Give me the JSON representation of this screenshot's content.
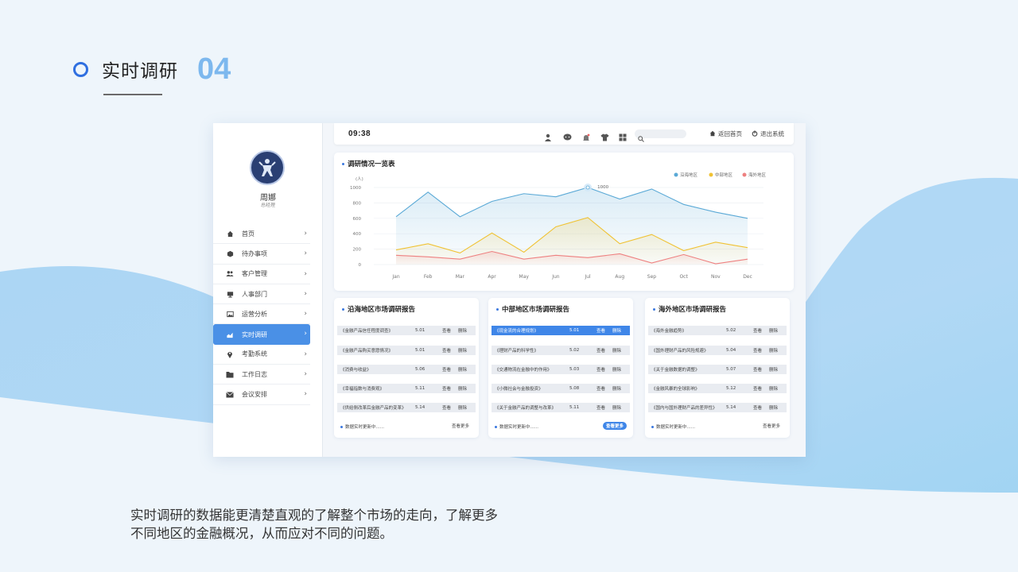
{
  "slide": {
    "title": "实时调研",
    "number": "04",
    "caption_line1": "实时调研的数据能更清楚直观的了解整个市场的走向，了解更多",
    "caption_line2": "不同地区的金融概况，从而应对不同的问题。"
  },
  "colors": {
    "accent_blue": "#2f6fe0",
    "menu_active": "#4a90e6",
    "series_coastal": "#5aa9d6",
    "series_central": "#f0c232",
    "series_overseas": "#ee8080"
  },
  "user": {
    "name": "周娜",
    "role": "总经理"
  },
  "sidebar": {
    "items": [
      {
        "label": "首页",
        "icon": "home-icon"
      },
      {
        "label": "待办事项",
        "icon": "box-icon"
      },
      {
        "label": "客户管理",
        "icon": "users-icon"
      },
      {
        "label": "人事部门",
        "icon": "monitor-icon"
      },
      {
        "label": "运营分析",
        "icon": "image-icon"
      },
      {
        "label": "实时调研",
        "icon": "area-chart-icon",
        "active": true
      },
      {
        "label": "考勤系统",
        "icon": "location-pin-icon"
      },
      {
        "label": "工作日志",
        "icon": "folder-icon"
      },
      {
        "label": "会议安排",
        "icon": "mail-icon"
      }
    ],
    "arrow": "›"
  },
  "topbar": {
    "time": "09:38",
    "icons": [
      "user-icon",
      "chat-icon",
      "bell-icon",
      "shirt-icon",
      "grid-icon"
    ],
    "search_placeholder": "",
    "home_label": "返回首页",
    "logout_label": "退出系统"
  },
  "chart_card": {
    "title": "调研情况一览表"
  },
  "chart_data": {
    "type": "area",
    "title": "调研情况一览表",
    "ylabel": "(人)",
    "ylim": [
      0,
      1000
    ],
    "yticks": [
      0,
      200,
      400,
      600,
      800,
      1000
    ],
    "categories": [
      "Jan",
      "Feb",
      "Mar",
      "Apr",
      "May",
      "Jun",
      "Jul",
      "Aug",
      "Sep",
      "Oct",
      "Nov",
      "Dec"
    ],
    "legend_position": "top-right",
    "grid": true,
    "annotation": {
      "label": "1000",
      "category": "Jul"
    },
    "series": [
      {
        "name": "沿海地区",
        "color": "#5aa9d6",
        "values": [
          620,
          940,
          620,
          820,
          920,
          880,
          1000,
          850,
          980,
          780,
          680,
          600
        ]
      },
      {
        "name": "中部地区",
        "color": "#f0c232",
        "values": [
          190,
          270,
          150,
          410,
          160,
          490,
          610,
          270,
          390,
          180,
          290,
          220
        ]
      },
      {
        "name": "海外地区",
        "color": "#ee8080",
        "values": [
          120,
          100,
          70,
          170,
          70,
          120,
          90,
          140,
          20,
          130,
          10,
          70
        ]
      }
    ]
  },
  "reports": [
    {
      "title": "沿海地区市场调研报告",
      "rows": [
        {
          "title": "《金融产品信任程度调查》",
          "date": "5.01",
          "view": "查看",
          "del": "删除"
        },
        {
          "title": "《金融产品购买意愿情况》",
          "date": "5.01",
          "view": "查看",
          "del": "删除"
        },
        {
          "title": "《消费与收益》",
          "date": "5.06",
          "view": "查看",
          "del": "删除"
        },
        {
          "title": "《幸福指数与消费观》",
          "date": "5.11",
          "view": "查看",
          "del": "删除"
        },
        {
          "title": "《供给侧改革后金融产品的变革》",
          "date": "5.14",
          "view": "查看",
          "del": "删除"
        }
      ],
      "footer": "数据实时更新中......",
      "more": "查看更多"
    },
    {
      "title": "中部地区市场调研报告",
      "rows": [
        {
          "title": "《现金流的合理规划》",
          "date": "5.01",
          "view": "查看",
          "del": "删除"
        },
        {
          "title": "《理财产品的科学性》",
          "date": "5.02",
          "view": "查看",
          "del": "删除"
        },
        {
          "title": "《交通物流在金融中的作用》",
          "date": "5.03",
          "view": "查看",
          "del": "删除"
        },
        {
          "title": "《小微社会与金融投资》",
          "date": "5.08",
          "view": "查看",
          "del": "删除"
        },
        {
          "title": "《关于金融产品的调整与改革》",
          "date": "5.11",
          "view": "查看",
          "del": "删除"
        }
      ],
      "footer": "数据实时更新中......",
      "more": "查看更多"
    },
    {
      "title": "海外地区市场调研报告",
      "rows": [
        {
          "title": "《海外金融趋势》",
          "date": "5.02",
          "view": "查看",
          "del": "删除"
        },
        {
          "title": "《国外理财产品的风险规避》",
          "date": "5.04",
          "view": "查看",
          "del": "删除"
        },
        {
          "title": "《关于金融数据的调整》",
          "date": "5.07",
          "view": "查看",
          "del": "删除"
        },
        {
          "title": "《金融风暴的全球影响》",
          "date": "5.12",
          "view": "查看",
          "del": "删除"
        },
        {
          "title": "《国内与国外理财产品的差异性》",
          "date": "5.14",
          "view": "查看",
          "del": "删除"
        }
      ],
      "footer": "数据实时更新中......",
      "more": "查看更多"
    }
  ]
}
